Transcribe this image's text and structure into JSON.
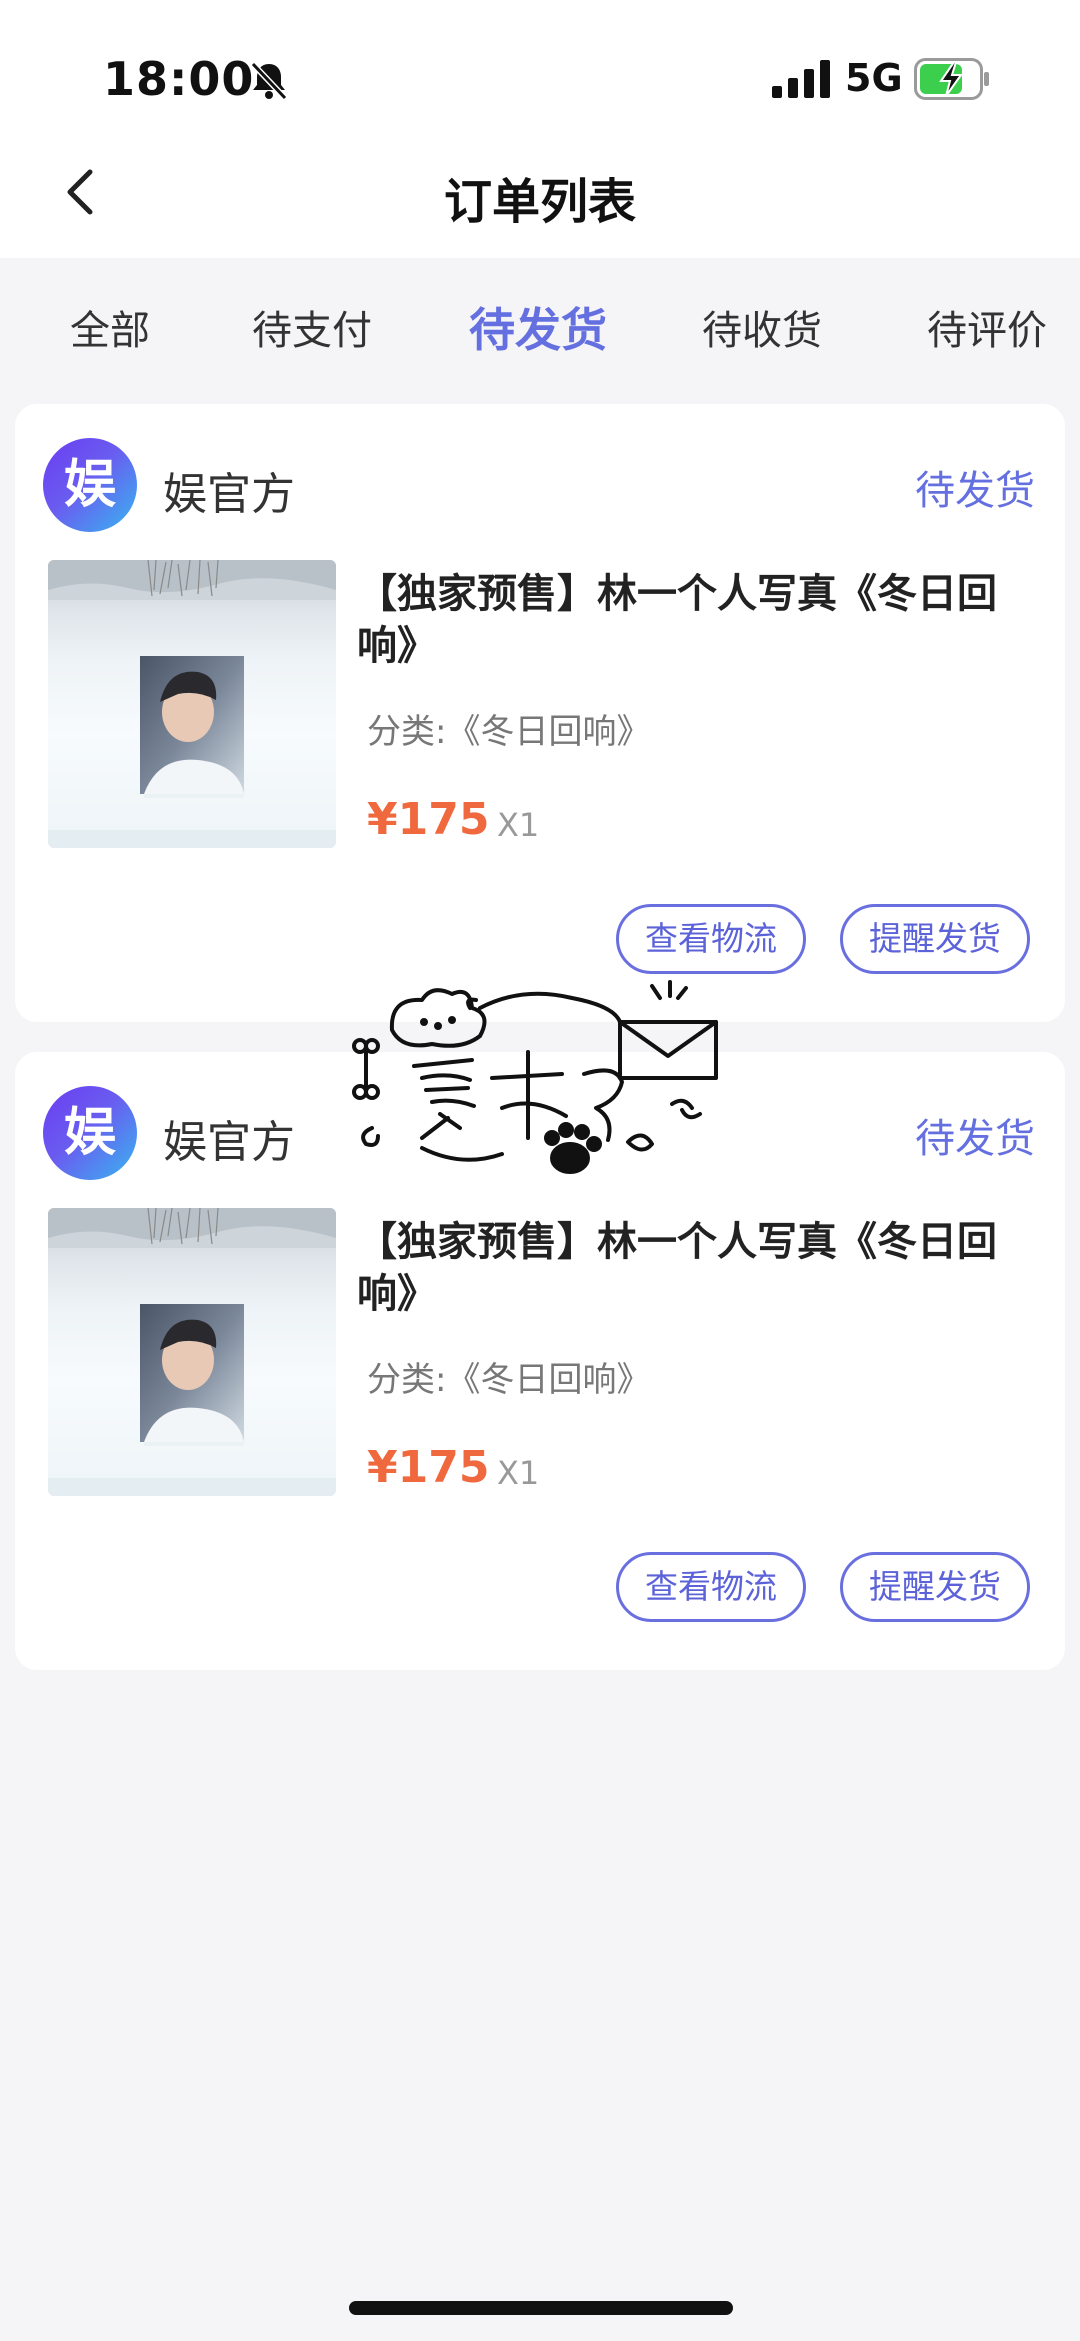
{
  "status_bar": {
    "time": "18:00",
    "network": "5G",
    "icons": [
      "bell-slash-icon",
      "signal-icon",
      "battery-charging-icon"
    ]
  },
  "nav": {
    "title": "订单列表",
    "back_icon": "chevron-left-icon"
  },
  "tabs": [
    {
      "label": "全部",
      "active": false
    },
    {
      "label": "待支付",
      "active": false
    },
    {
      "label": "待发货",
      "active": true
    },
    {
      "label": "待收货",
      "active": false
    },
    {
      "label": "待评价",
      "active": false
    }
  ],
  "orders": [
    {
      "shop_name": "娱官方",
      "shop_logo_text": "娱",
      "status": "待发货",
      "product_title": "【独家预售】林一个人写真《冬日回响》",
      "category": "分类:《冬日回响》",
      "price": "¥175",
      "quantity": "X1",
      "buttons": {
        "logistics": "查看物流",
        "remind": "提醒发货"
      }
    },
    {
      "shop_name": "娱官方",
      "shop_logo_text": "娱",
      "status": "待发货",
      "product_title": "【独家预售】林一个人写真《冬日回响》",
      "category": "分类:《冬日回响》",
      "price": "¥175",
      "quantity": "X1",
      "buttons": {
        "logistics": "查看物流",
        "remind": "提醒发货"
      }
    }
  ],
  "colors": {
    "accent": "#6570e0",
    "price": "#f0683e",
    "background": "#f5f5f7"
  }
}
